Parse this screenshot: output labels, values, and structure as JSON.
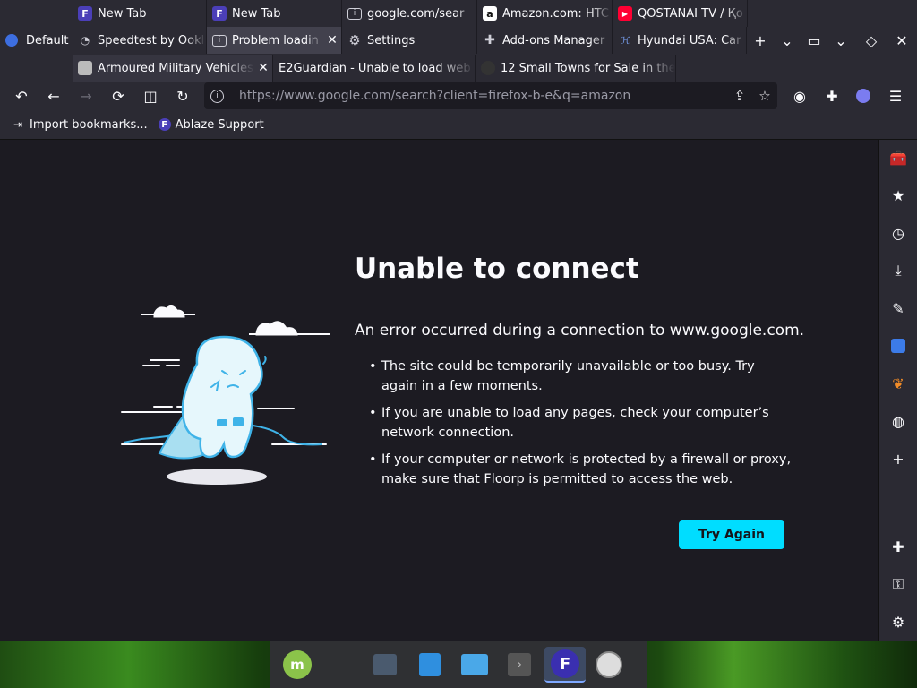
{
  "profile": {
    "label": "Default"
  },
  "tabs_row1": [
    {
      "title": "New Tab",
      "icon": "floorp-icon"
    },
    {
      "title": "New Tab",
      "icon": "floorp-icon"
    },
    {
      "title": "google.com/sear",
      "icon": "info-icon"
    },
    {
      "title": "Amazon.com: HTC",
      "icon": "amazon-icon"
    },
    {
      "title": "QOSTANAI TV / Қо",
      "icon": "youtube-icon"
    }
  ],
  "tabs_row2": [
    {
      "title": "Speedtest by Ookl",
      "icon": "speedtest-icon"
    },
    {
      "title": "Problem loadin",
      "icon": "info-icon",
      "selected": true
    },
    {
      "title": "Settings",
      "icon": "gear-icon"
    },
    {
      "title": "Add-ons Manager",
      "icon": "puzzle-icon"
    },
    {
      "title": "Hyundai USA: Car",
      "icon": "hyundai-icon"
    }
  ],
  "tabs_row3": [
    {
      "title": "Armoured Military Vehicles",
      "icon": "page-thumb-icon"
    },
    {
      "title": "E2Guardian - Unable to load web",
      "icon": "none"
    },
    {
      "title": "12 Small Towns for Sale in the",
      "icon": "page-thumb-icon"
    }
  ],
  "tab_controls": {
    "new_tab": "+",
    "list_all": "⌄",
    "window": "▭",
    "more": "⌄",
    "diamond": "◇",
    "close": "✕"
  },
  "urlbar": {
    "url": "https://www.google.com/search?client=firefox-b-e&q=amazon"
  },
  "bookmarks": [
    {
      "label": "Import bookmarks...",
      "icon": "import-icon"
    },
    {
      "label": "Ablaze Support",
      "icon": "floorp-icon"
    }
  ],
  "error": {
    "title": "Unable to connect",
    "description": "An error occurred during a connection to www.google.com.",
    "items": [
      "The site could be temporarily unavailable or too busy. Try again in a few moments.",
      "If you are unable to load any pages, check your computer’s network connection.",
      "If your computer or network is protected by a firewall or proxy, make sure that Floorp is permitted to access the web."
    ],
    "button": "Try Again"
  },
  "sidebar": [
    "toolbox-icon",
    "bookmark-star-icon",
    "history-clock-icon",
    "downloads-icon",
    "notes-pencil-icon",
    "translate-icon",
    "extension-leaf-icon",
    "web-globe-icon",
    "add-panel-icon",
    "extensions-icon",
    "passwords-key-icon",
    "settings-gear-icon"
  ],
  "taskbar": [
    "mint-menu-icon",
    "settings-icon",
    "software-store-icon",
    "files-icon",
    "terminal-icon",
    "floorp-browser-icon",
    "web-app-icon"
  ],
  "colors": {
    "accent": "#00ddff",
    "page_bg": "#1c1b22",
    "chrome_bg": "#2b2a33",
    "selected_tab": "#42414d"
  }
}
